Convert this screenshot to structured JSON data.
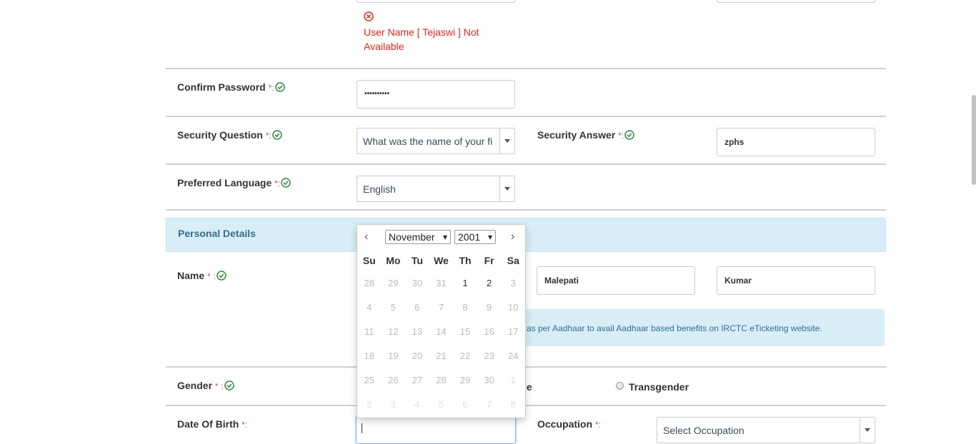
{
  "error": {
    "message": "User Name [ Tejaswi ] Not Available"
  },
  "fields": {
    "confirm_password": {
      "label": "Confirm Password",
      "value": "••••••••••"
    },
    "security_question": {
      "label": "Security Question",
      "value": "What was the name of your fi"
    },
    "security_answer": {
      "label": "Security Answer",
      "value": "zphs"
    },
    "preferred_language": {
      "label": "Preferred Language",
      "value": "English"
    },
    "name": {
      "label": "Name",
      "middle_name": "Malepati",
      "last_name": "Kumar"
    },
    "gender": {
      "label": "Gender",
      "visible_option_fragment": "le",
      "transgender": "Transgender"
    },
    "dob": {
      "label": "Date Of Birth",
      "value": ""
    },
    "occupation": {
      "label": "Occupation",
      "value": "Select Occupation"
    }
  },
  "required_marker": "*",
  "section": {
    "personal_details": "Personal Details"
  },
  "info": {
    "aadhaar": "as per Aadhaar to avail Aadhaar based benefits on IRCTC eTicketing website."
  },
  "calendar": {
    "month": "November",
    "year": "2001",
    "weekdays": [
      "Su",
      "Mo",
      "Tu",
      "We",
      "Th",
      "Fr",
      "Sa"
    ],
    "weeks": [
      [
        [
          "28",
          "prev"
        ],
        [
          "29",
          "prev"
        ],
        [
          "30",
          "prev"
        ],
        [
          "31",
          "prev"
        ],
        [
          "1",
          "cur"
        ],
        [
          "2",
          "cur"
        ],
        [
          "3",
          "dis"
        ]
      ],
      [
        [
          "4",
          "dis"
        ],
        [
          "5",
          "dis"
        ],
        [
          "6",
          "dis"
        ],
        [
          "7",
          "dis"
        ],
        [
          "8",
          "dis"
        ],
        [
          "9",
          "dis"
        ],
        [
          "10",
          "dis"
        ]
      ],
      [
        [
          "11",
          "dis"
        ],
        [
          "12",
          "dis"
        ],
        [
          "13",
          "dis"
        ],
        [
          "14",
          "dis"
        ],
        [
          "15",
          "dis"
        ],
        [
          "16",
          "dis"
        ],
        [
          "17",
          "dis"
        ]
      ],
      [
        [
          "18",
          "dis"
        ],
        [
          "19",
          "dis"
        ],
        [
          "20",
          "dis"
        ],
        [
          "21",
          "dis"
        ],
        [
          "22",
          "dis"
        ],
        [
          "23",
          "dis"
        ],
        [
          "24",
          "dis"
        ]
      ],
      [
        [
          "25",
          "dis"
        ],
        [
          "26",
          "dis"
        ],
        [
          "27",
          "dis"
        ],
        [
          "28",
          "dis"
        ],
        [
          "29",
          "dis"
        ],
        [
          "30",
          "dis"
        ],
        [
          "1",
          "next"
        ]
      ],
      [
        [
          "2",
          "next"
        ],
        [
          "3",
          "next"
        ],
        [
          "4",
          "next"
        ],
        [
          "5",
          "next"
        ],
        [
          "6",
          "next"
        ],
        [
          "7",
          "next"
        ],
        [
          "8",
          "next"
        ]
      ]
    ]
  },
  "colors": {
    "error": "#e2231a",
    "section_bg": "#d9edf7",
    "section_text": "#31708f",
    "check": "#2e8b3e"
  }
}
